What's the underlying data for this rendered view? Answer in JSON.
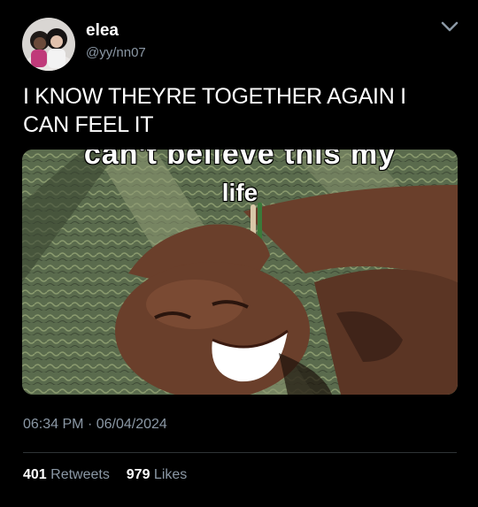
{
  "tweet": {
    "author": {
      "display_name": "elea",
      "handle": "@yy/nn07"
    },
    "text": "I KNOW THEYRE TOGETHER AGAIN I CAN FEEL IT",
    "media": {
      "caption_line_1": "can't believe this my",
      "caption_line_2": "life"
    },
    "time": "06:34 PM",
    "separator": "·",
    "date": "06/04/2024",
    "stats": {
      "retweets_count": "401",
      "retweets_label": "Retweets",
      "likes_count": "979",
      "likes_label": "Likes"
    }
  },
  "icons": {
    "menu": "chevron-down-icon"
  },
  "colors": {
    "background": "#000000",
    "text_primary": "#ffffff",
    "text_secondary": "#8b98a5",
    "divider": "#2f3336"
  }
}
